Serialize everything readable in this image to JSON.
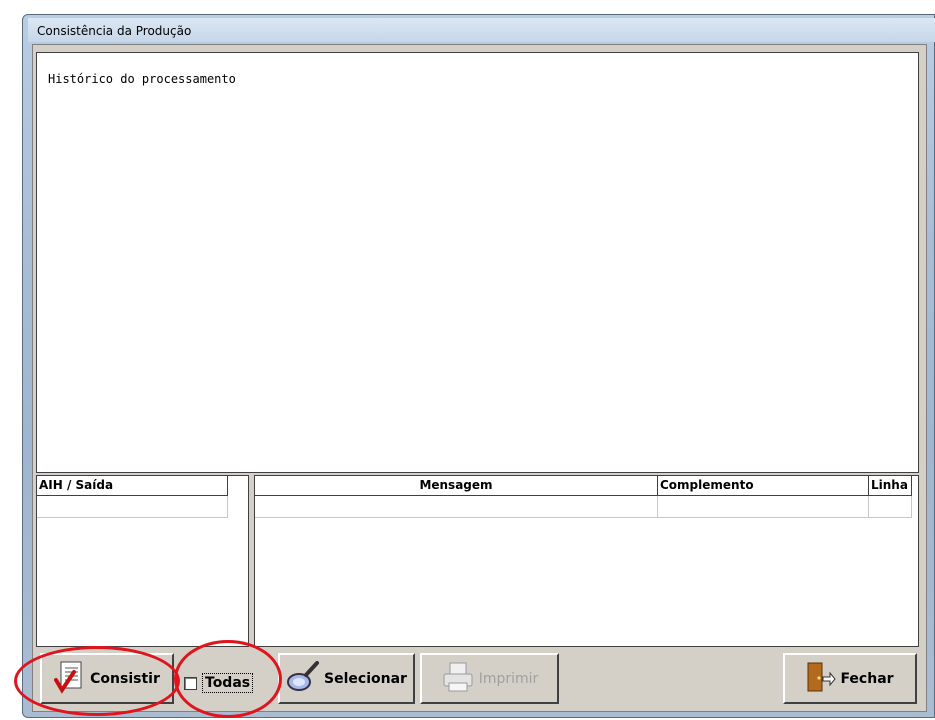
{
  "window": {
    "title": "Consistência da Produção"
  },
  "log": {
    "text": "Histórico do processamento"
  },
  "grid_left": {
    "columns": [
      "AIH / Saída"
    ]
  },
  "grid_right": {
    "columns": [
      "Mensagem",
      "Complemento",
      "Linha"
    ]
  },
  "toolbar": {
    "consistir_label": "Consistir",
    "todas_label": "Todas",
    "todas_checked": false,
    "selecionar_label": "Selecionar",
    "imprimir_label": "Imprimir",
    "fechar_label": "Fechar"
  },
  "icons": {
    "consistir": "checklist-icon",
    "selecionar": "magnifier-icon",
    "imprimir": "printer-icon",
    "fechar": "exit-door-icon"
  },
  "colors": {
    "annotation": "#e0141c",
    "face": "#d4d0c8"
  }
}
